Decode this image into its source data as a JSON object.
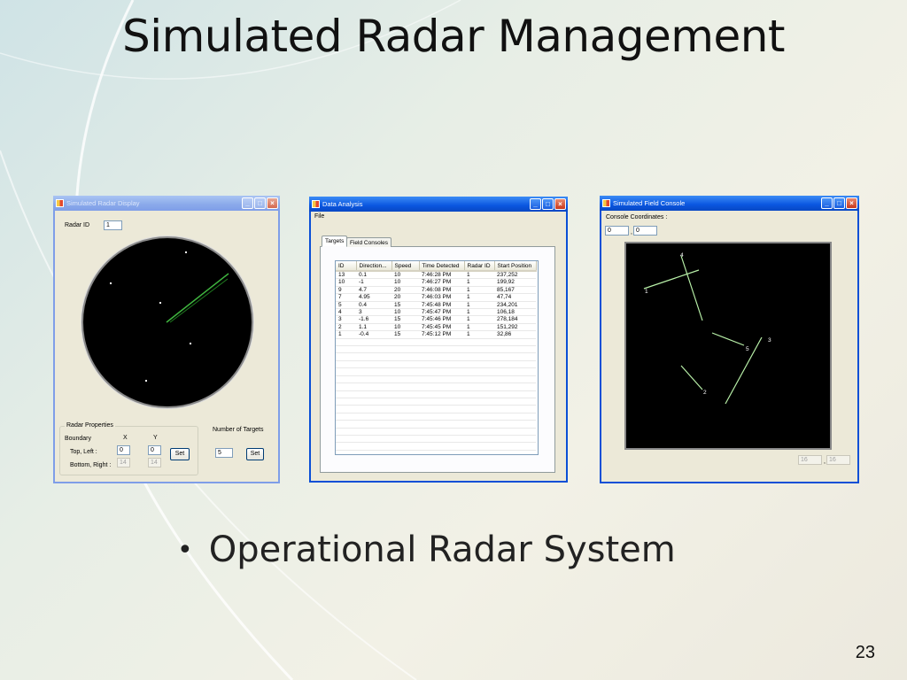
{
  "slide": {
    "title": "Simulated Radar Management",
    "bullet": "Operational Radar System",
    "page_number": "23"
  },
  "radar_display": {
    "title": "Simulated Radar Display",
    "radar_id_label": "Radar ID",
    "radar_id_value": "1",
    "properties_group": "Radar Properties",
    "boundary_label": "Boundary",
    "x_label": "X",
    "y_label": "Y",
    "top_left_label": "Top, Left :",
    "top_left_x": "0",
    "top_left_y": "0",
    "bottom_right_label": "Bottom, Right :",
    "bottom_right_x": "14",
    "bottom_right_y": "14",
    "set_label": "Set",
    "num_targets_label": "Number of Targets",
    "num_targets_value": "5",
    "set2_label": "Set"
  },
  "data_analysis": {
    "title": "Data Analysis",
    "menu_file": "File",
    "tabs": [
      "Targets",
      "Field Consoles"
    ],
    "columns": [
      "ID",
      "Direction...",
      "Speed",
      "Time Detected",
      "Radar ID",
      "Start Position"
    ],
    "rows": [
      [
        "13",
        "0.1",
        "10",
        "7:46:28 PM",
        "1",
        "237,252"
      ],
      [
        "10",
        "-1",
        "10",
        "7:46:27 PM",
        "1",
        "199,92"
      ],
      [
        "9",
        "4.7",
        "20",
        "7:46:08 PM",
        "1",
        "85,167"
      ],
      [
        "7",
        "4.95",
        "20",
        "7:46:03 PM",
        "1",
        "47,74"
      ],
      [
        "5",
        "0.4",
        "15",
        "7:45:48 PM",
        "1",
        "234,201"
      ],
      [
        "4",
        "3",
        "10",
        "7:45:47 PM",
        "1",
        "106,18"
      ],
      [
        "3",
        "-1.6",
        "15",
        "7:45:46 PM",
        "1",
        "278,184"
      ],
      [
        "2",
        "1.1",
        "10",
        "7:45:45 PM",
        "1",
        "151,292"
      ],
      [
        "1",
        "-0.4",
        "15",
        "7:45:12 PM",
        "1",
        "32,86"
      ]
    ]
  },
  "field_console": {
    "title": "Simulated Field Console",
    "coords_label": "Console Coordinates :",
    "coord_x": "0",
    "coord_y": "0",
    "track_labels": [
      "4",
      "1",
      "3",
      "5",
      "2"
    ],
    "bottom_x": "16",
    "bottom_y": "16",
    "comma": ","
  }
}
